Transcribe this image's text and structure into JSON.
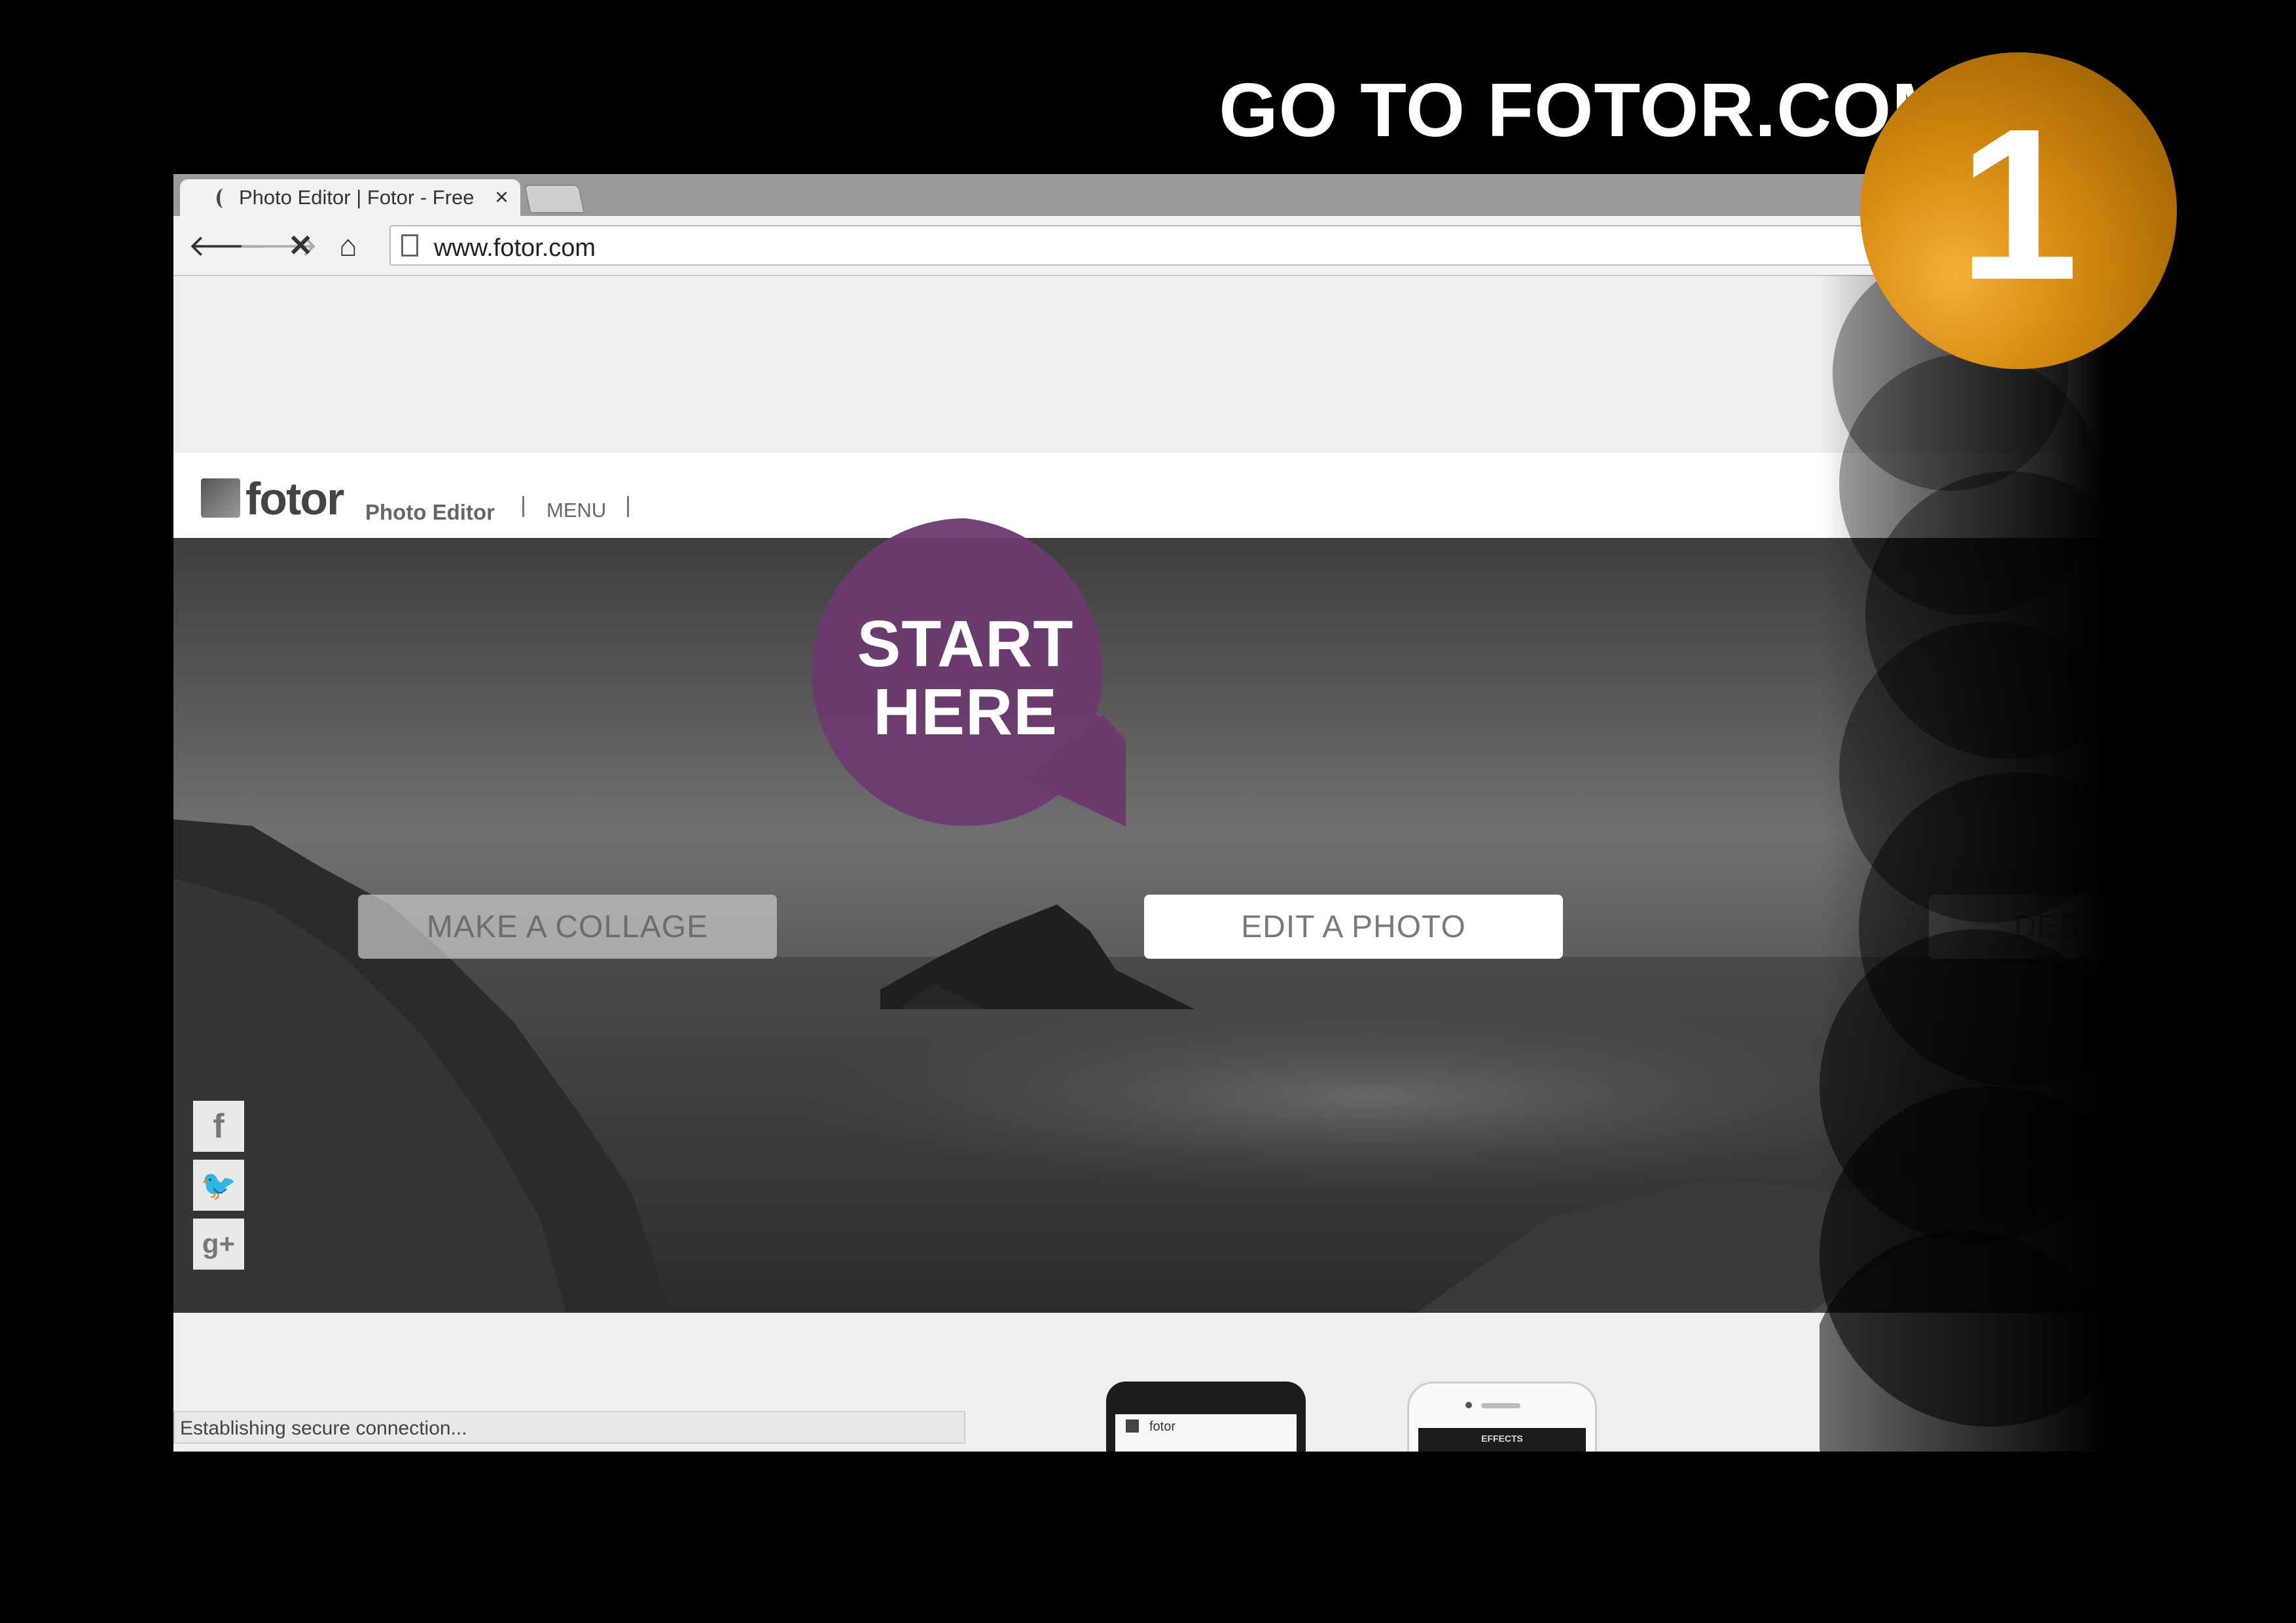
{
  "heading": "GO TO FOTOR.COM",
  "step_number": "1",
  "callout": {
    "line1": "START",
    "line2": "HERE"
  },
  "browser": {
    "tab_title": "Photo Editor | Fotor - Free",
    "tab_close": "×",
    "url": "www.fotor.com",
    "status": "Establishing secure connection..."
  },
  "site": {
    "logo": "fotor",
    "logo_sub": "Photo Editor",
    "menu": "MENU",
    "buttons": {
      "collage": "MAKE A COLLAGE",
      "edit": "EDIT A PHOTO",
      "design": "DESI"
    },
    "social": {
      "facebook": "f",
      "twitter": "🐦",
      "googleplus": "g+"
    },
    "android_app_name": "fotor",
    "ios_screen_label": "EFFECTS"
  },
  "colors": {
    "badge": "#c07a0c",
    "callout": "#6c3a6e",
    "background": "#000000"
  },
  "icons": [
    "back-arrow-icon",
    "forward-arrow-icon",
    "stop-icon",
    "home-icon",
    "page-icon",
    "facebook-icon",
    "twitter-icon",
    "googleplus-icon"
  ]
}
